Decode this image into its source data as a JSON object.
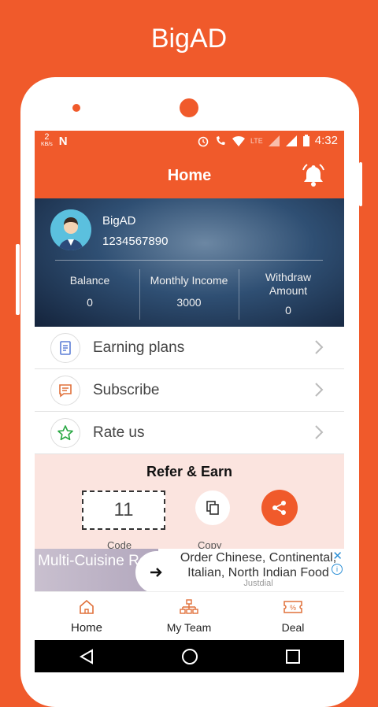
{
  "brand": "BigAD",
  "status": {
    "left_text": "2",
    "left_sub": "KB/s",
    "time": "4:32"
  },
  "appbar": {
    "title": "Home"
  },
  "profile": {
    "name": "BigAD",
    "phone": "1234567890",
    "stats": [
      {
        "label": "Balance",
        "value": "0"
      },
      {
        "label": "Monthly Income",
        "value": "3000"
      },
      {
        "label": "Withdraw Amount",
        "value": "0"
      }
    ]
  },
  "menu": [
    {
      "label": "Earning plans",
      "icon": "document-icon"
    },
    {
      "label": "Subscribe",
      "icon": "message-icon"
    },
    {
      "label": "Rate us",
      "icon": "star-icon"
    }
  ],
  "refer": {
    "title": "Refer & Earn",
    "code": "11",
    "code_label": "Code",
    "copy_label": "Copy"
  },
  "ad": {
    "left_text": "Multi-Cuisine Restaurants",
    "right_text": "Order Chinese, Continental, Italian, North Indian Food",
    "source": "Justdial"
  },
  "tabs": [
    {
      "label": "Home",
      "icon": "home-icon"
    },
    {
      "label": "My Team",
      "icon": "team-icon"
    },
    {
      "label": "Deal",
      "icon": "deal-icon"
    }
  ],
  "colors": {
    "accent": "#f05a2b",
    "star": "#2aa844"
  }
}
